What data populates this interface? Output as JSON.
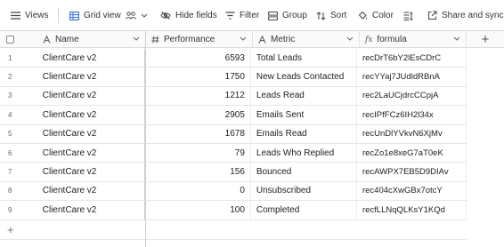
{
  "toolbar": {
    "views_label": "Views",
    "grid_view_label": "Grid view",
    "hide_fields_label": "Hide fields",
    "filter_label": "Filter",
    "group_label": "Group",
    "sort_label": "Sort",
    "color_label": "Color",
    "share_label": "Share and sync"
  },
  "columns": {
    "name": "Name",
    "performance": "Performance",
    "metric": "Metric",
    "formula": "formula"
  },
  "rows": [
    {
      "num": "1",
      "name": "ClientCare v2",
      "performance": "6593",
      "metric": "Total Leads",
      "formula": "recDrT6bY2lEsCDrC"
    },
    {
      "num": "2",
      "name": "ClientCare v2",
      "performance": "1750",
      "metric": "New Leads Contacted",
      "formula": "recYYaj7JUdldRBnA"
    },
    {
      "num": "3",
      "name": "ClientCare v2",
      "performance": "1212",
      "metric": "Leads Read",
      "formula": "rec2LaUCjdrcCCpjA"
    },
    {
      "num": "4",
      "name": "ClientCare v2",
      "performance": "2905",
      "metric": "Emails Sent",
      "formula": "recIPfFCz6IH2l34x"
    },
    {
      "num": "5",
      "name": "ClientCare v2",
      "performance": "1678",
      "metric": "Emails Read",
      "formula": "recUnDlYVkvN6XjMv"
    },
    {
      "num": "6",
      "name": "ClientCare v2",
      "performance": "79",
      "metric": "Leads Who Replied",
      "formula": "recZo1e8xeG7aT0eK"
    },
    {
      "num": "7",
      "name": "ClientCare v2",
      "performance": "156",
      "metric": "Bounced",
      "formula": "recAWPX7EB5D9DIAv"
    },
    {
      "num": "8",
      "name": "ClientCare v2",
      "performance": "0",
      "metric": "Unsubscribed",
      "formula": "rec404cXwGBx7otcY"
    },
    {
      "num": "9",
      "name": "ClientCare v2",
      "performance": "100",
      "metric": "Completed",
      "formula": "recfLLNqQLKsY1KQd"
    }
  ],
  "add_row_label": "+",
  "add_column_label": "+"
}
